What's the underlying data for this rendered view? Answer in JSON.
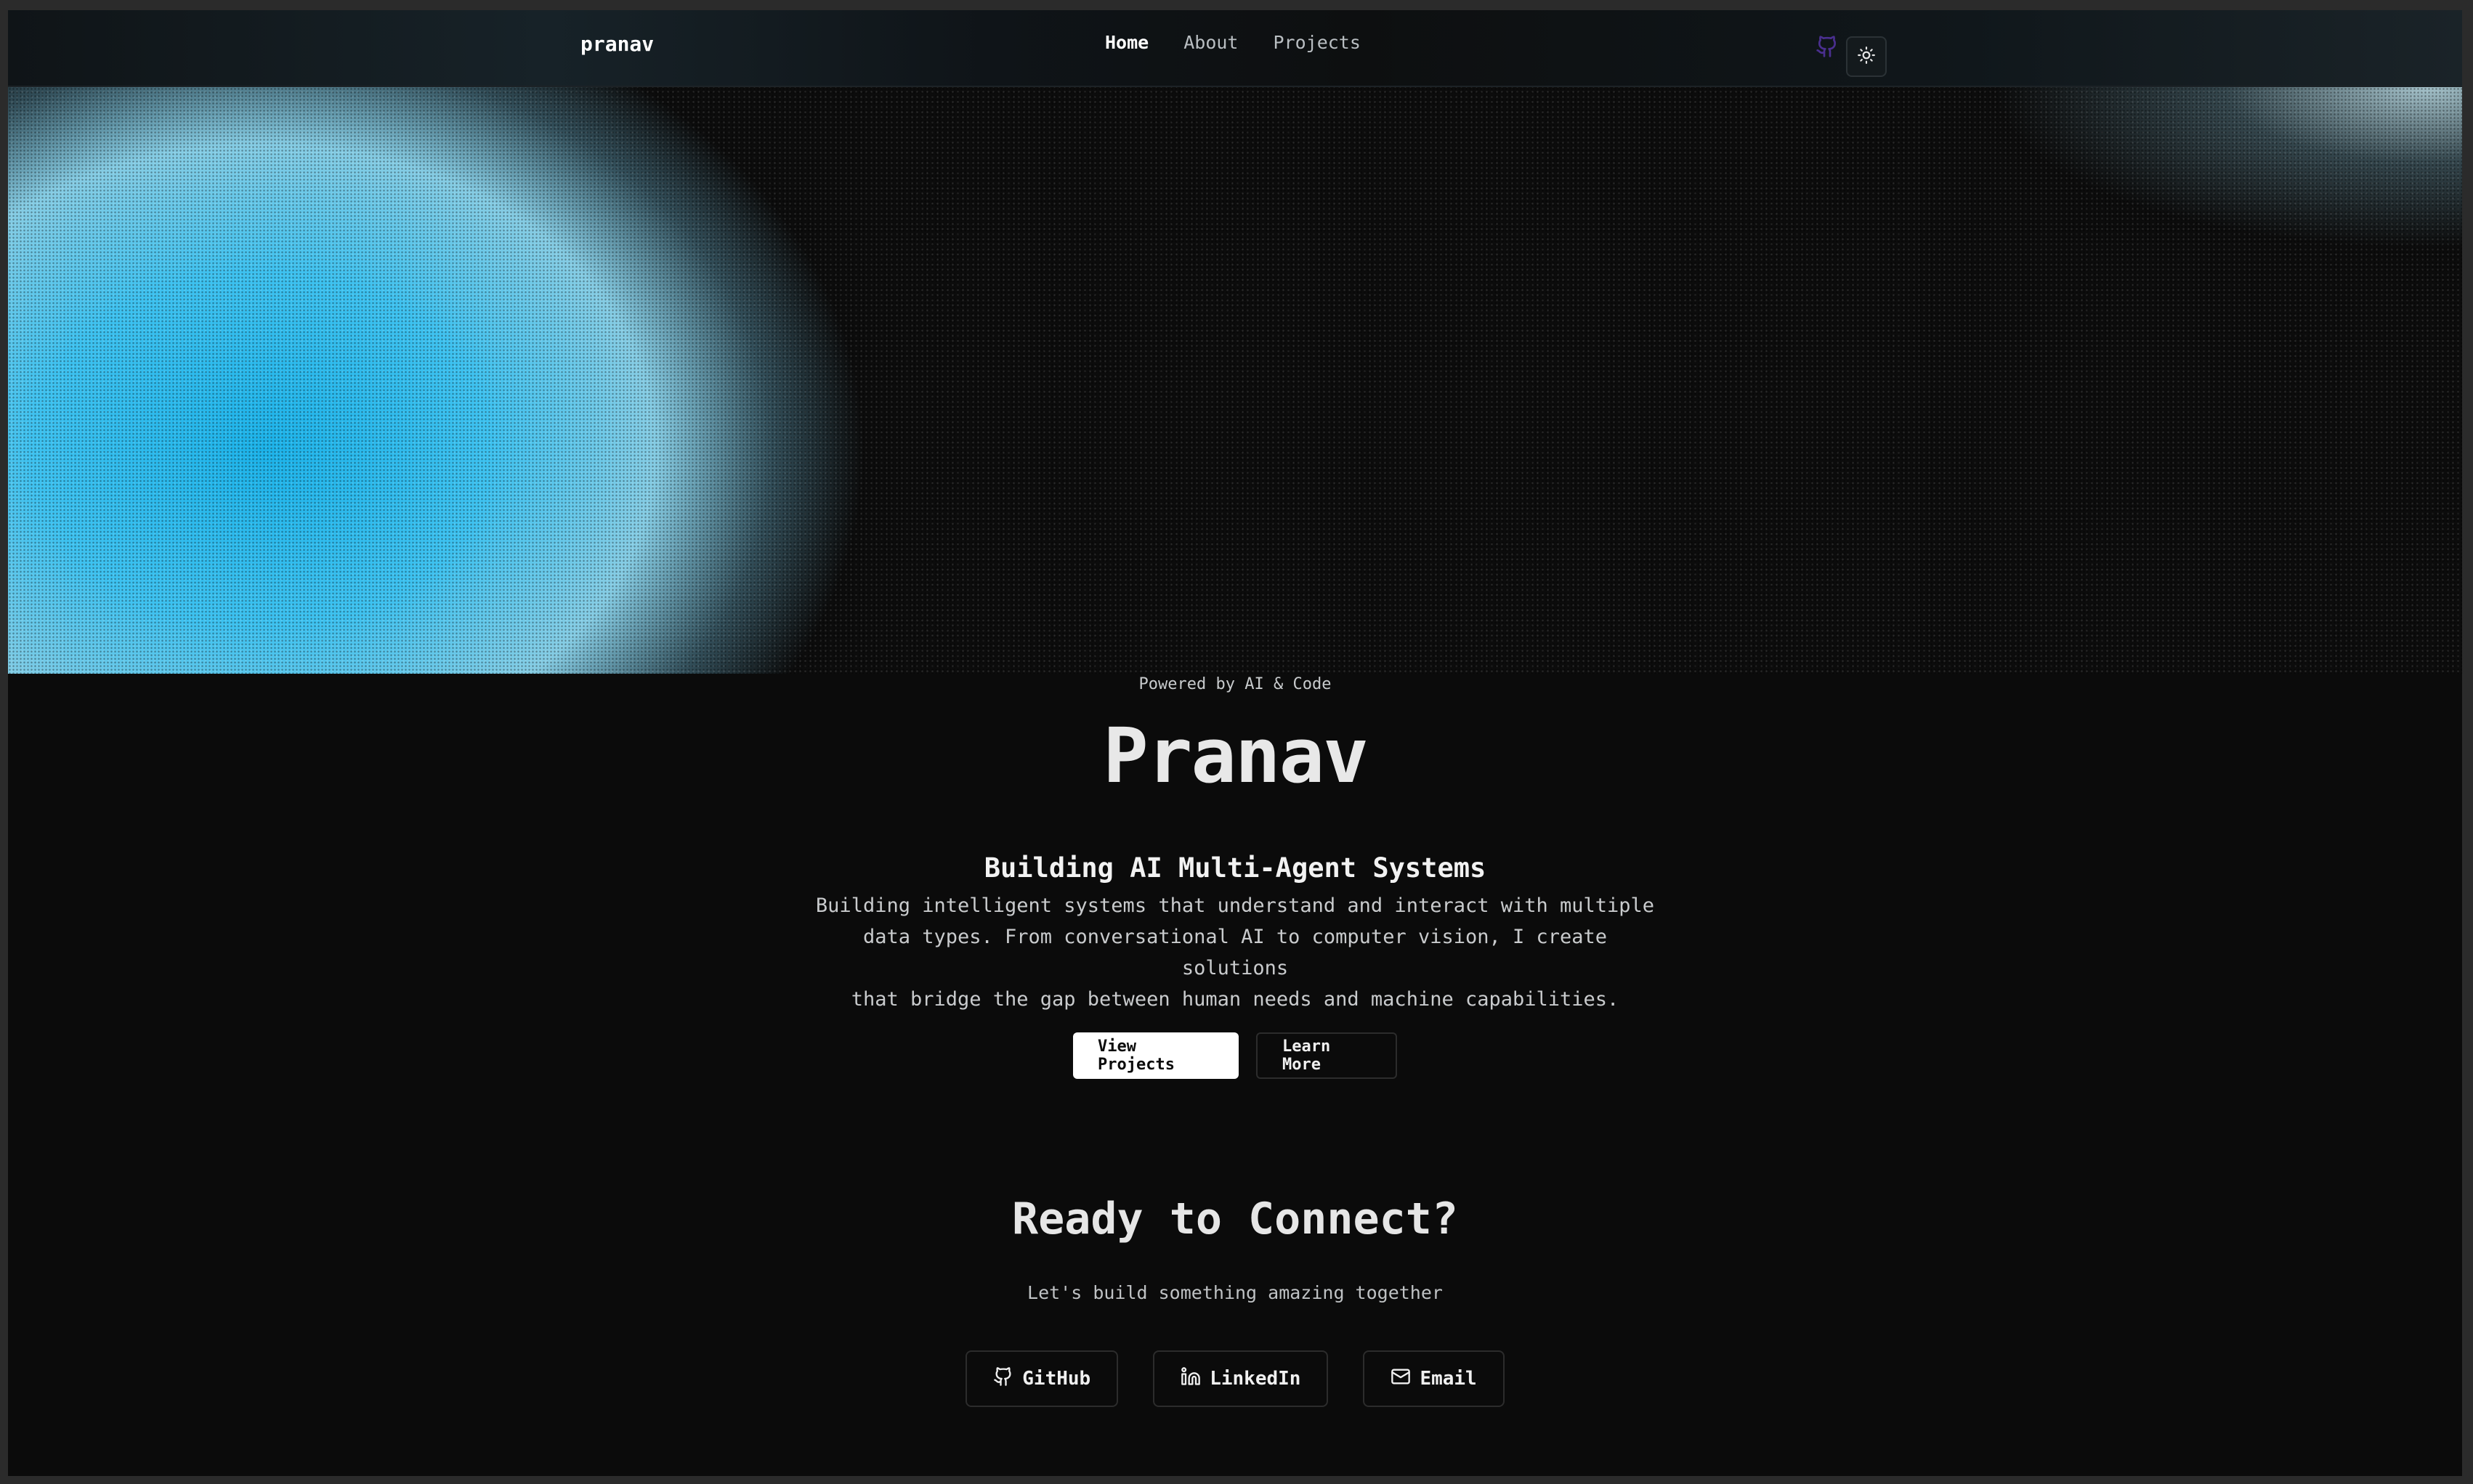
{
  "nav": {
    "brand": "pranav",
    "links": [
      {
        "label": "Home",
        "active": true
      },
      {
        "label": "About",
        "active": false
      },
      {
        "label": "Projects",
        "active": false
      }
    ],
    "github_icon": "github-icon",
    "theme_icon": "sun-icon"
  },
  "hero": {
    "tagline": "Powered by AI & Code",
    "name": "Pranav",
    "subtitle": "Building AI Multi-Agent Systems",
    "description_lines": [
      "Building intelligent systems that understand and interact with multiple",
      "data types. From conversational AI to computer vision, I create solutions",
      "that bridge the gap between human needs and machine capabilities."
    ],
    "primary_button": "View Projects",
    "secondary_button": "Learn More"
  },
  "connect": {
    "title": "Ready to Connect?",
    "subtitle": "Let's build something amazing together",
    "links": [
      {
        "label": "GitHub",
        "icon": "github-icon"
      },
      {
        "label": "LinkedIn",
        "icon": "linkedin-icon"
      },
      {
        "label": "Email",
        "icon": "mail-icon"
      }
    ]
  },
  "colors": {
    "accent_blue": "#1cb3ea",
    "background": "#0b0b0b"
  }
}
